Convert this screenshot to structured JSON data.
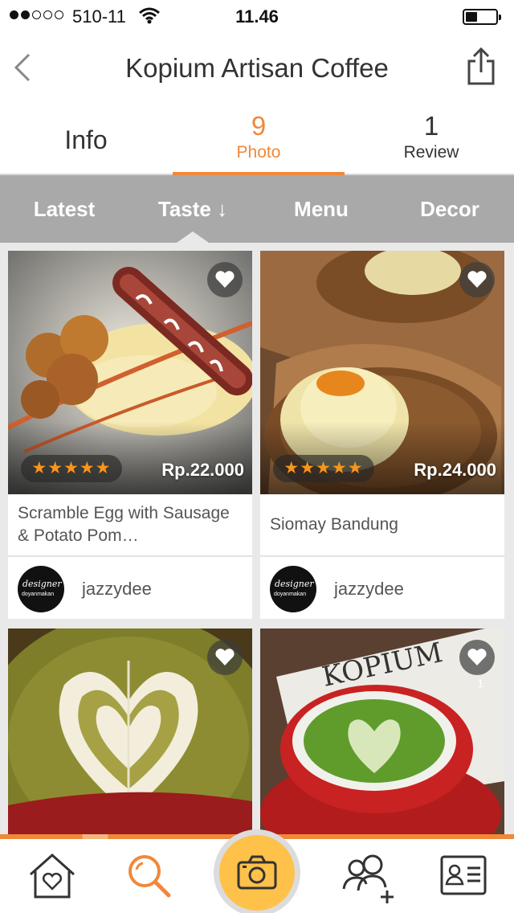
{
  "status_bar": {
    "carrier": "510-11",
    "time": "11.46"
  },
  "header": {
    "title": "Kopium Artisan Coffee"
  },
  "main_tabs": {
    "info": "Info",
    "photo_count": "9",
    "photo": "Photo",
    "review_count": "1",
    "review": "Review"
  },
  "filters": {
    "latest": "Latest",
    "taste": "Taste ↓",
    "menu": "Menu",
    "decor": "Decor"
  },
  "cards": [
    {
      "name": "Scramble Egg with Sausage & Potato Pom…",
      "price": "Rp.22.000",
      "rating": 5,
      "stars": "★★★★★",
      "user": "jazzydee",
      "avatar_text": "designer",
      "avatar_sub": "doyanmakan"
    },
    {
      "name": "Siomay Bandung",
      "price": "Rp.24.000",
      "rating": 5,
      "stars": "★★★★★",
      "user": "jazzydee",
      "avatar_text": "designer",
      "avatar_sub": "doyanmakan"
    },
    {
      "like_count": ""
    },
    {
      "like_count": "1",
      "sign_text": "KOPIUM"
    }
  ],
  "colors": {
    "accent": "#f0883a",
    "filter_bg": "#a9a9a9",
    "star": "#f7951d",
    "camera": "#fec14a"
  },
  "bottom_tabs": [
    "home-heart-icon",
    "search-icon",
    "camera-icon",
    "add-friend-icon",
    "profile-card-icon"
  ]
}
